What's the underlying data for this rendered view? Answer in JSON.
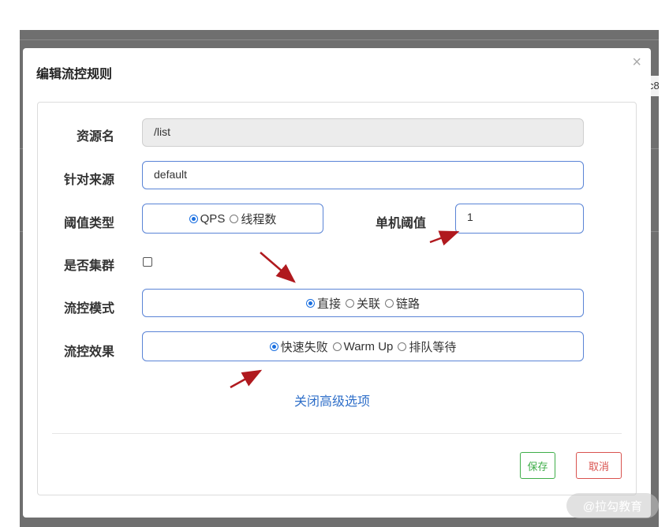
{
  "dialog": {
    "title": "编辑流控规则",
    "close_symbol": "×",
    "background_peek_text": "c8"
  },
  "form": {
    "resource": {
      "label": "资源名",
      "value": "/list"
    },
    "source": {
      "label": "针对来源",
      "value": "default"
    },
    "threshold_type": {
      "label": "阈值类型",
      "options": [
        {
          "label": "QPS",
          "selected": true
        },
        {
          "label": "线程数",
          "selected": false
        }
      ]
    },
    "single_threshold": {
      "label": "单机阈值",
      "value": "1"
    },
    "cluster": {
      "label": "是否集群",
      "checked": false
    },
    "flow_mode": {
      "label": "流控模式",
      "options": [
        {
          "label": "直接",
          "selected": true
        },
        {
          "label": "关联",
          "selected": false
        },
        {
          "label": "链路",
          "selected": false
        }
      ]
    },
    "flow_effect": {
      "label": "流控效果",
      "options": [
        {
          "label": "快速失败",
          "selected": true
        },
        {
          "label": "Warm Up",
          "selected": false
        },
        {
          "label": "排队等待",
          "selected": false
        }
      ]
    },
    "advanced_link": "关闭高级选项"
  },
  "footer": {
    "save_label": "保存",
    "cancel_label": "取消"
  },
  "watermark": "@拉勾教育",
  "colors": {
    "input_border": "#5a84d6",
    "radio_selected": "#1a6fe0",
    "link": "#2f6fc9",
    "save": "#3fae49",
    "cancel": "#d9534f",
    "annotation_arrow": "#b0191e"
  }
}
